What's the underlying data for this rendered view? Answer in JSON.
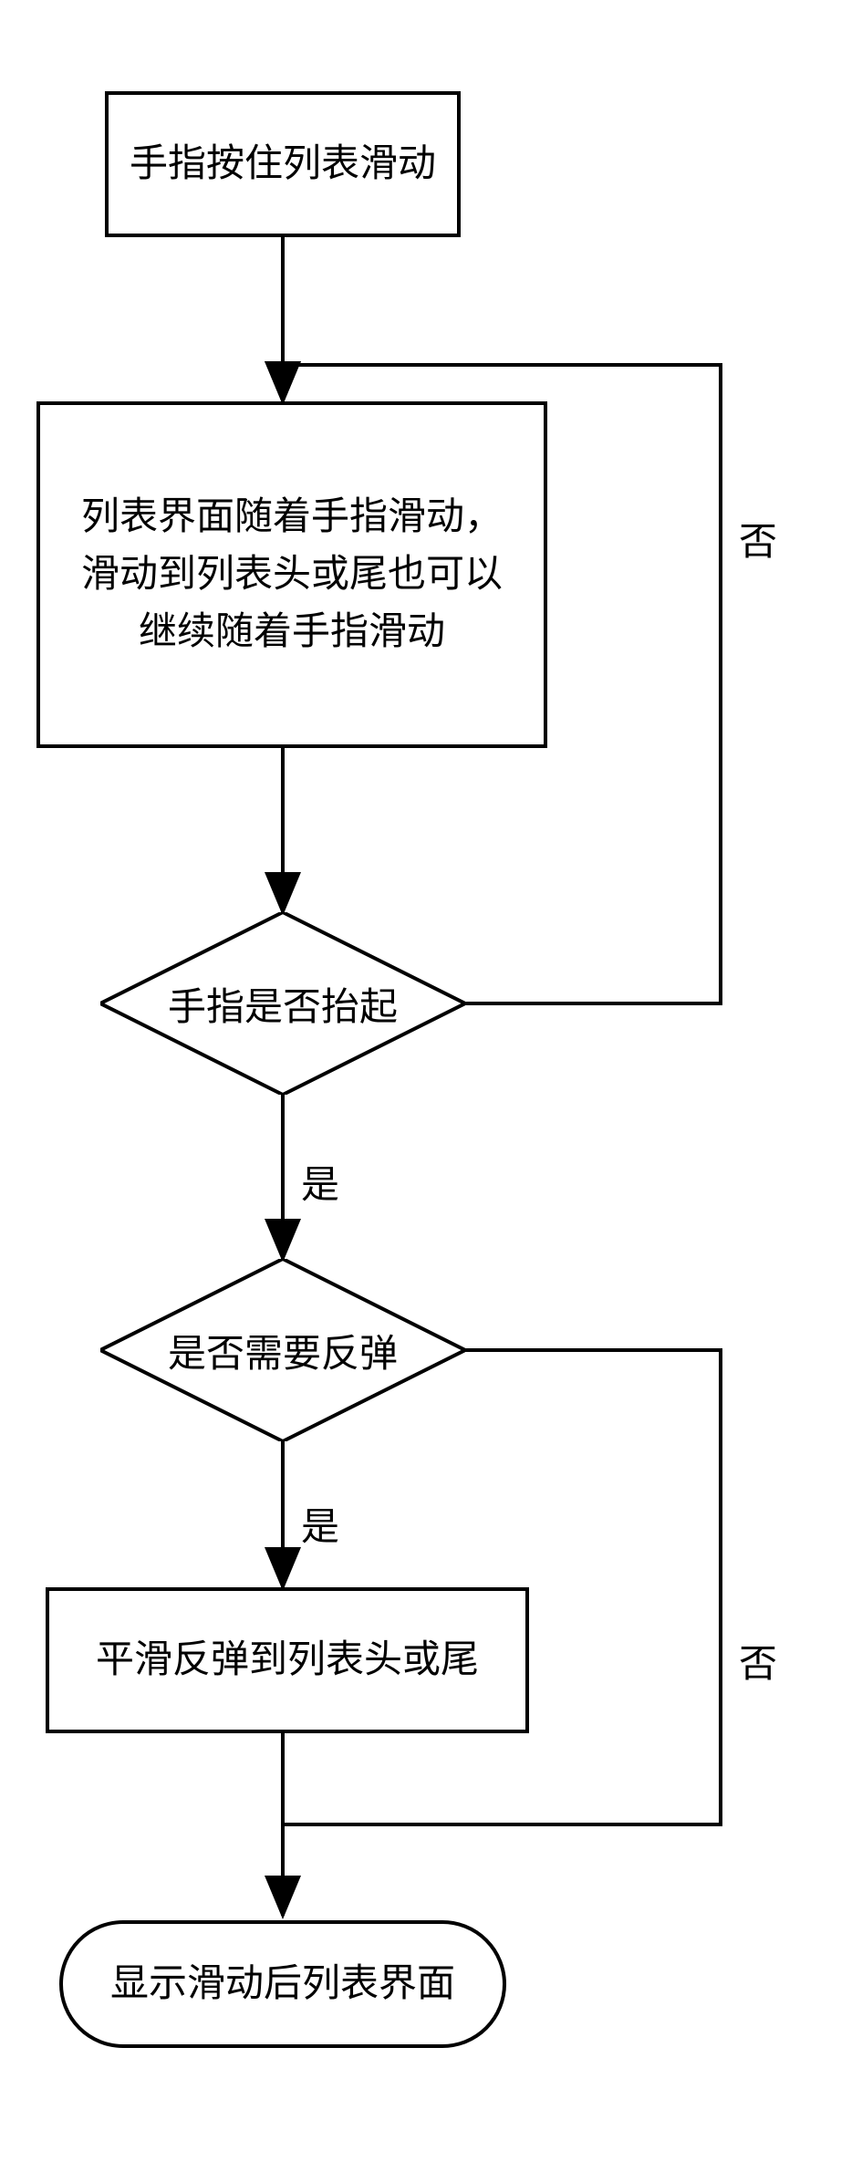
{
  "nodes": {
    "start": "手指按住列表滑动",
    "process1_line1": "列表界面随着手指滑动，",
    "process1_line2": "滑动到列表头或尾也可以",
    "process1_line3": "继续随着手指滑动",
    "decision1": "手指是否抬起",
    "decision2": "是否需要反弹",
    "process2": "平滑反弹到列表头或尾",
    "end": "显示滑动后列表界面"
  },
  "labels": {
    "no": "否",
    "yes": "是"
  }
}
